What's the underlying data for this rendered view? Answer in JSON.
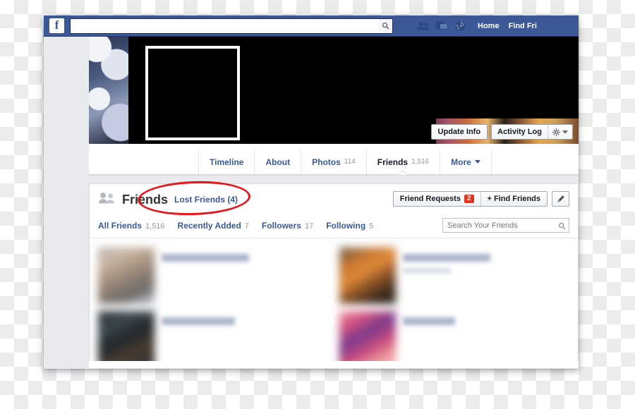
{
  "window": {
    "chrome_color": "#3b5998",
    "page_bg": "#e9eaed"
  },
  "topbar": {
    "logo_letter": "f",
    "logo_name": "facebook-logo",
    "search": {
      "value": "",
      "placeholder": ""
    },
    "icons": [
      {
        "name": "friend-requests-icon",
        "label": "Friend Requests"
      },
      {
        "name": "messages-icon",
        "label": "Messages"
      },
      {
        "name": "notifications-globe-icon",
        "label": "Notifications"
      }
    ],
    "links": [
      {
        "label": "Home"
      },
      {
        "label": "Find Fri"
      }
    ]
  },
  "cover": {
    "profile_picture_state": "redacted",
    "buttons": {
      "update_info": "Update Info",
      "activity_log": "Activity Log"
    }
  },
  "tabs": [
    {
      "label": "Timeline",
      "count": "",
      "active": false
    },
    {
      "label": "About",
      "count": "",
      "active": false
    },
    {
      "label": "Photos",
      "count": "114",
      "active": false
    },
    {
      "label": "Friends",
      "count": "1,516",
      "active": true
    },
    {
      "label": "More",
      "count": "",
      "active": false,
      "has_caret": true
    }
  ],
  "friends_section": {
    "heading": "Friends",
    "lost_friends_link": "Lost Friends (4)",
    "highlight_color": "#e8151b",
    "actions": {
      "friend_requests_label": "Friend Requests",
      "friend_requests_badge": "2",
      "badge_color": "#e2341d",
      "find_friends_label": "+ Find Friends",
      "edit_icon": "pencil-icon"
    },
    "subnav": [
      {
        "label": "All Friends",
        "count": "1,516"
      },
      {
        "label": "Recently Added",
        "count": "7"
      },
      {
        "label": "Followers",
        "count": "17"
      },
      {
        "label": "Following",
        "count": "5"
      }
    ],
    "search": {
      "value": "",
      "placeholder": "Search Your Friends"
    },
    "friends": [
      {
        "name": "",
        "subtitle": "",
        "avatar_class": "fa-1",
        "name_class": "long"
      },
      {
        "name": "",
        "subtitle": "",
        "avatar_class": "fa-3",
        "name_class": "long"
      },
      {
        "name": "",
        "subtitle": "",
        "avatar_class": "fa-2",
        "name_class": ""
      },
      {
        "name": "",
        "subtitle": "",
        "avatar_class": "fa-4",
        "name_class": "short"
      }
    ]
  }
}
